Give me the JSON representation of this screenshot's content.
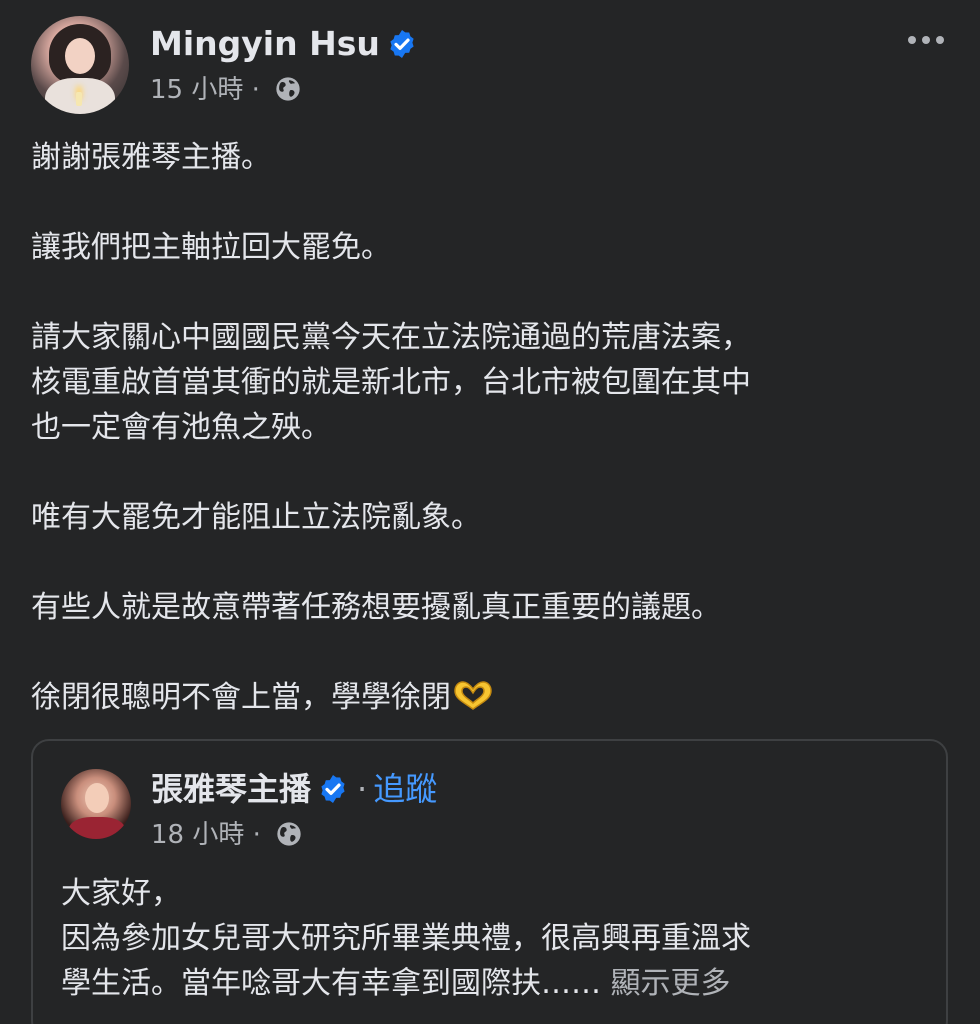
{
  "post": {
    "author": "Mingyin Hsu",
    "time": "15 小時",
    "separator": "·",
    "paragraphs": [
      "謝謝張雅琴主播。",
      "讓我們把主軸拉回大罷免。",
      "請大家關心中國國民黨今天在立法院通過的荒唐法案，\n核電重啟首當其衝的就是新北市，台北市被包圍在其中\n也一定會有池魚之殃。",
      "唯有大罷免才能阻止立法院亂象。",
      "有些人就是故意帶著任務想要擾亂真正重要的議題。",
      "徐閉很聰明不會上當，學學徐閉"
    ]
  },
  "shared_post": {
    "author": "張雅琴主播",
    "separator": "·",
    "follow_label": "追蹤",
    "time": "18 小時",
    "text": "大家好，\n因為參加女兒哥大研究所畢業典禮，很高興再重溫求\n學生活。當年唸哥大有幸拿到國際扶…… ",
    "see_more_label": "顯示更多"
  },
  "colors": {
    "background": "#242526",
    "text_primary": "#e4e6eb",
    "text_secondary": "#b0b3b8",
    "verified_blue": "#1877f2",
    "link_blue": "#4599ff",
    "emoji_yellow": "#f7c531"
  },
  "icons": {
    "verified": "verified-badge-icon",
    "audience": "globe-icon",
    "menu": "more-options-icon",
    "emoji": "heart-hands-emoji"
  }
}
